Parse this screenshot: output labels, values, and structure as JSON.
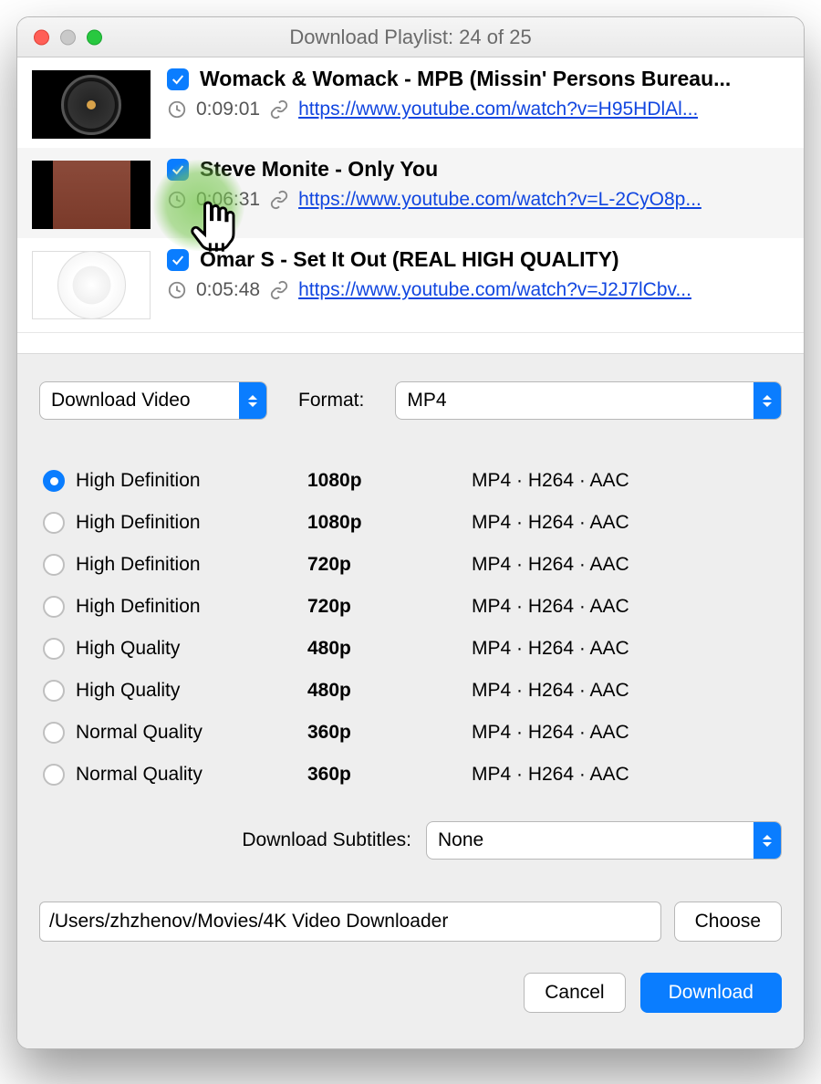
{
  "window": {
    "title": "Download Playlist: 24 of 25"
  },
  "playlist": {
    "items": [
      {
        "checked": true,
        "title": "Womack & Womack - MPB (Missin' Persons Bureau...",
        "duration": "0:09:01",
        "url": "https://www.youtube.com/watch?v=H95HDlAl..."
      },
      {
        "checked": true,
        "title": "Steve Monite - Only You",
        "duration": "0:06:31",
        "url": "https://www.youtube.com/watch?v=L-2CyO8p..."
      },
      {
        "checked": true,
        "title": "Omar S - Set It Out (REAL HIGH QUALITY)",
        "duration": "0:05:48",
        "url": "https://www.youtube.com/watch?v=J2J7lCbv..."
      }
    ]
  },
  "settings": {
    "download_mode": "Download Video",
    "format_label": "Format:",
    "format_value": "MP4",
    "subtitles_label": "Download Subtitles:",
    "subtitles_value": "None",
    "path": "/Users/zhzhenov/Movies/4K Video Downloader",
    "choose_label": "Choose"
  },
  "quality": [
    {
      "selected": true,
      "name": "High Definition",
      "res": "1080p",
      "codec": "MP4 · H264 · AAC"
    },
    {
      "selected": false,
      "name": "High Definition",
      "res": "1080p",
      "codec": "MP4 · H264 · AAC"
    },
    {
      "selected": false,
      "name": "High Definition",
      "res": "720p",
      "codec": "MP4 · H264 · AAC"
    },
    {
      "selected": false,
      "name": "High Definition",
      "res": "720p",
      "codec": "MP4 · H264 · AAC"
    },
    {
      "selected": false,
      "name": "High Quality",
      "res": "480p",
      "codec": "MP4 · H264 · AAC"
    },
    {
      "selected": false,
      "name": "High Quality",
      "res": "480p",
      "codec": "MP4 · H264 · AAC"
    },
    {
      "selected": false,
      "name": "Normal Quality",
      "res": "360p",
      "codec": "MP4 · H264 · AAC"
    },
    {
      "selected": false,
      "name": "Normal Quality",
      "res": "360p",
      "codec": "MP4 · H264 · AAC"
    }
  ],
  "footer": {
    "cancel": "Cancel",
    "download": "Download"
  }
}
